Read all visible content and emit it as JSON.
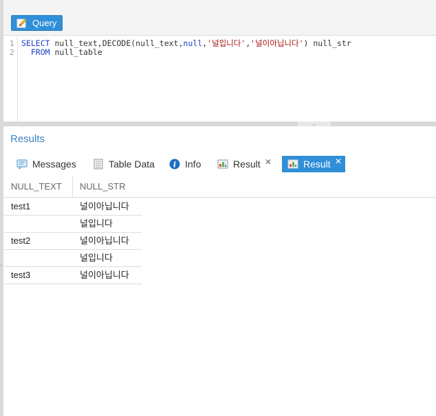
{
  "toolbar": {
    "query_label": "Query"
  },
  "editor": {
    "line_numbers": [
      "1",
      "2"
    ],
    "line1": {
      "kw1": "SELECT",
      "p1": " null_text,DECODE(null_text,",
      "kw2": "null",
      "p2": ",",
      "s1": "'널입니다'",
      "p3": ",",
      "s2": "'널이아닙니다'",
      "p4": ") null_str"
    },
    "line2": {
      "indent": "  ",
      "kw": "FROM",
      "rest": " null_table"
    }
  },
  "results": {
    "title": "Results",
    "tabs": [
      {
        "label": "Messages",
        "icon": "messages-icon"
      },
      {
        "label": "Table Data",
        "icon": "table-data-icon"
      },
      {
        "label": "Info",
        "icon": "info-icon"
      },
      {
        "label": "Result",
        "icon": "result-icon",
        "close": "✕"
      },
      {
        "label": "Result",
        "icon": "result-icon",
        "close": "✕",
        "active": true
      }
    ],
    "columns": [
      "NULL_TEXT",
      "NULL_STR"
    ],
    "rows": [
      [
        "test1",
        "널이아닙니다"
      ],
      [
        "",
        "널입니다"
      ],
      [
        "test2",
        "널이아닙니다"
      ],
      [
        "",
        "널입니다"
      ],
      [
        "test3",
        "널이아닙니다"
      ]
    ]
  },
  "colors": {
    "accent": "#2f8fd8",
    "title": "#3c84c4",
    "keyword": "#1a3fc4",
    "string": "#a31515"
  }
}
